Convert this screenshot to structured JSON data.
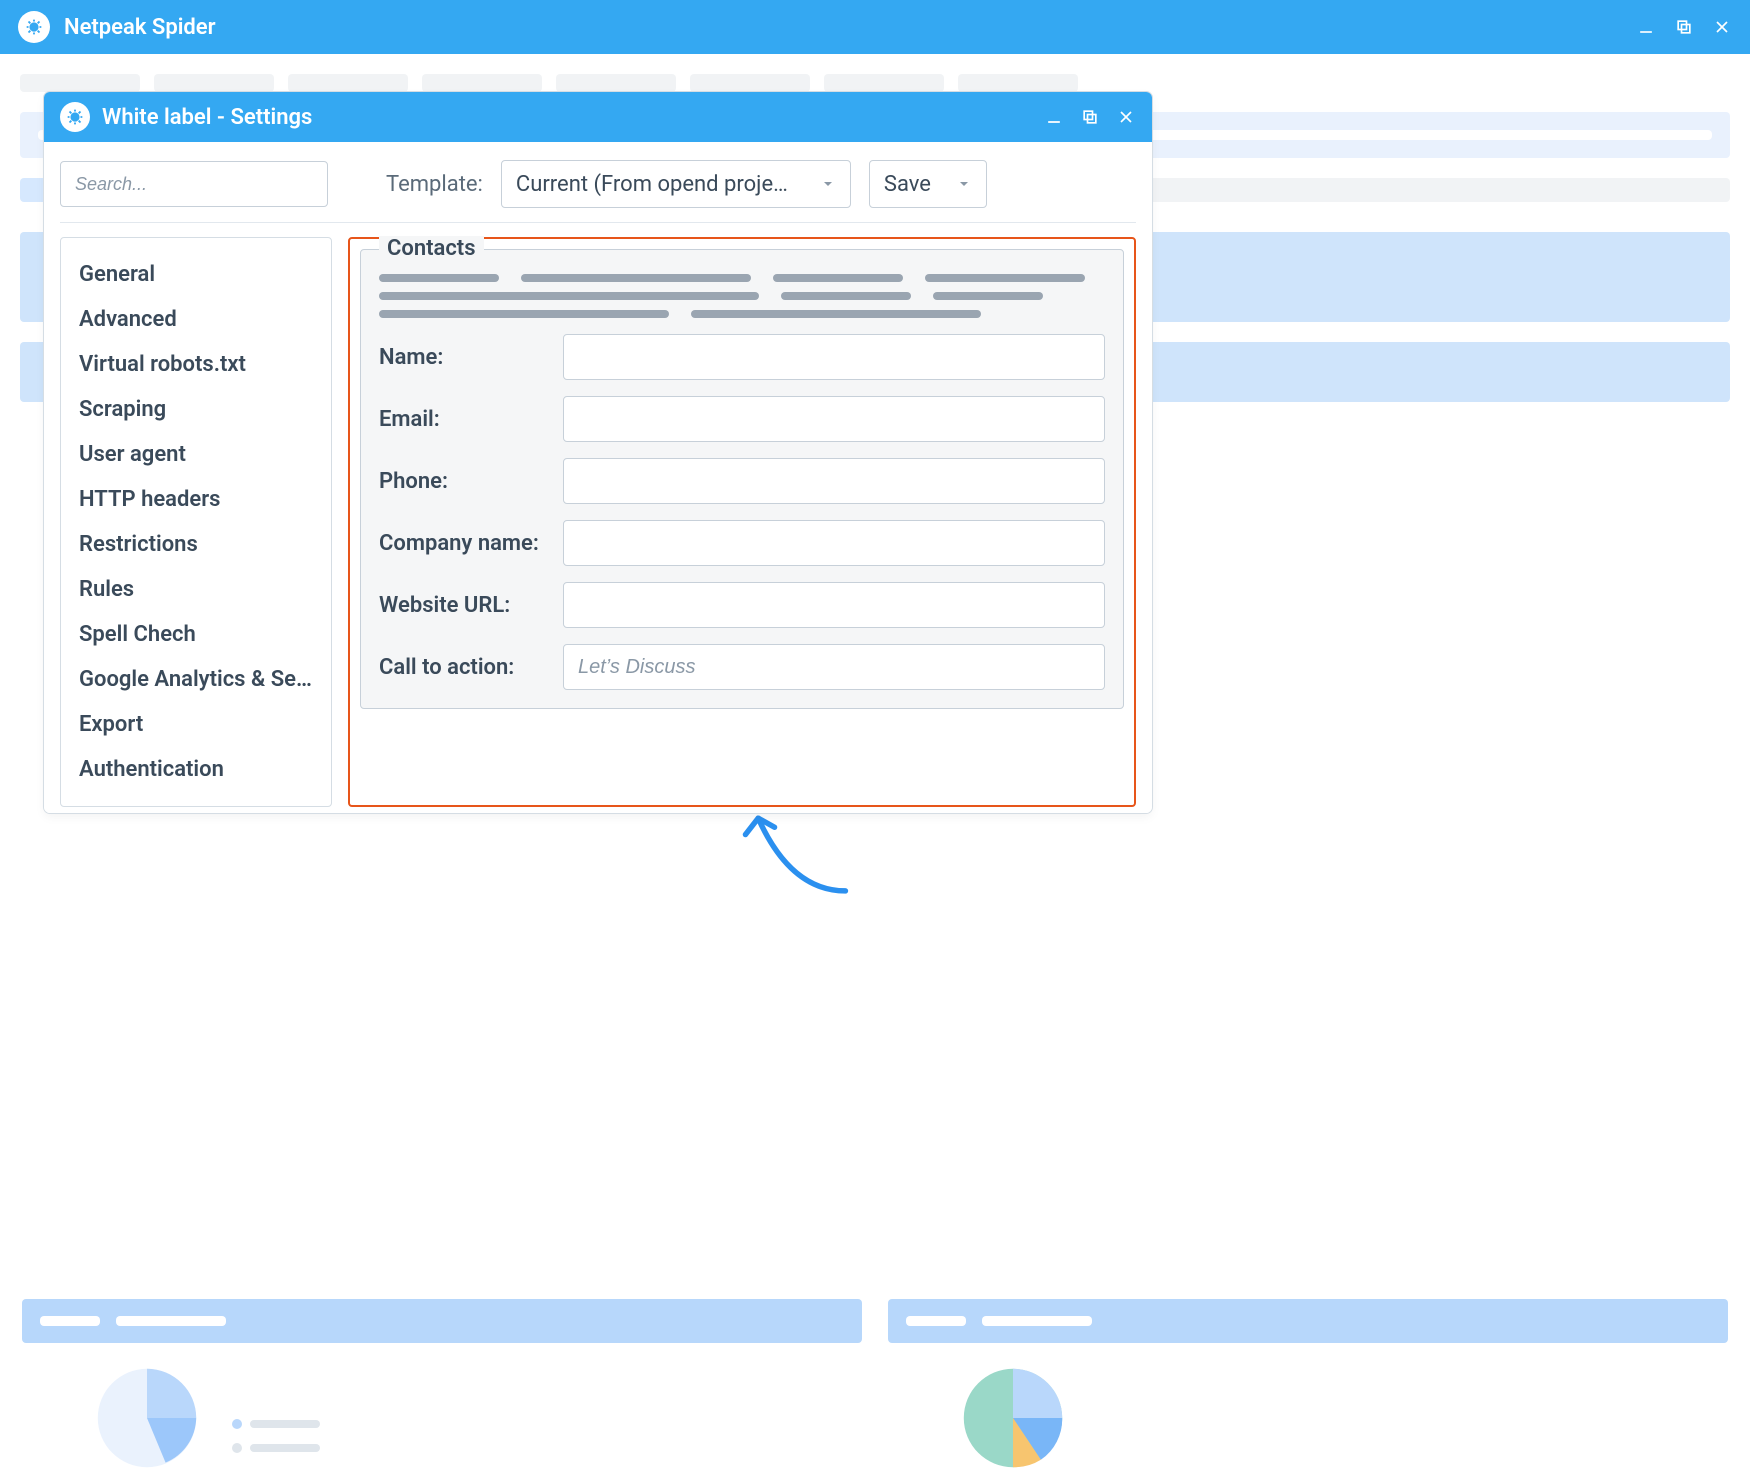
{
  "app": {
    "title": "Netpeak Spider"
  },
  "modal": {
    "title": "White label - Settings",
    "search_placeholder": "Search...",
    "template_label": "Template:",
    "template_value": "Current (From opend proje…",
    "save_label": "Save",
    "sidebar": {
      "items": [
        "General",
        "Advanced",
        "Virtual robots.txt",
        "Scraping",
        "User agent",
        "HTTP headers",
        "Restrictions",
        "Rules",
        "Spell Chech",
        "Google Analytics & Se...",
        "Export",
        "Authentication"
      ]
    },
    "panel": {
      "legend": "Contacts",
      "fields": {
        "name": "Name:",
        "email": "Email:",
        "phone": "Phone:",
        "company": "Company name:",
        "website": "Website URL:",
        "cta": "Call to action:"
      },
      "cta_placeholder": "Let’s Discuss"
    }
  }
}
